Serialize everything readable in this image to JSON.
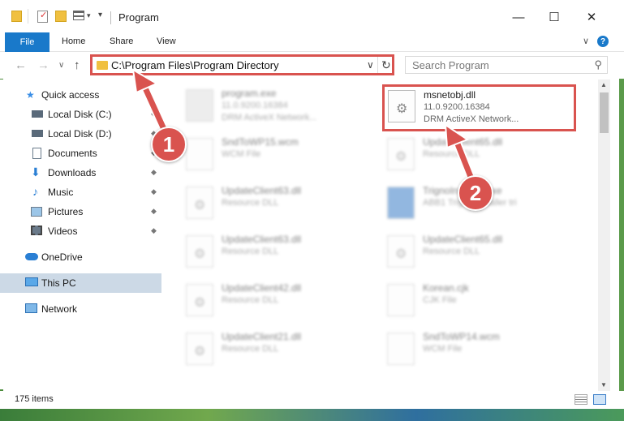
{
  "window": {
    "title": "Program",
    "minimize_glyph": "—",
    "maximize_glyph": "☐",
    "close_glyph": "✕"
  },
  "ribbon": {
    "tabs": [
      "File",
      "Home",
      "Share",
      "View"
    ],
    "help_glyph": "?",
    "collapse_glyph": "∨"
  },
  "nav": {
    "back_glyph": "←",
    "forward_glyph": "→",
    "recent_glyph": "∨",
    "up_glyph": "↑",
    "address_path": "C:\\Program Files\\Program Directory",
    "address_dropdown_glyph": "∨",
    "refresh_glyph": "↻",
    "search_placeholder": "Search Program",
    "search_icon_glyph": "⚲"
  },
  "sidebar": {
    "items": [
      {
        "label": "Quick access",
        "icon": "star-icon",
        "pinned": false
      },
      {
        "label": "Local Disk (C:)",
        "icon": "drive-icon",
        "pinned": true
      },
      {
        "label": "Local Disk (D:)",
        "icon": "drive-icon",
        "pinned": true
      },
      {
        "label": "Documents",
        "icon": "documents-icon",
        "pinned": true
      },
      {
        "label": "Downloads",
        "icon": "download-icon",
        "pinned": true
      },
      {
        "label": "Music",
        "icon": "music-icon",
        "pinned": true
      },
      {
        "label": "Pictures",
        "icon": "pictures-icon",
        "pinned": true
      },
      {
        "label": "Videos",
        "icon": "videos-icon",
        "pinned": true
      },
      {
        "label": "OneDrive",
        "icon": "cloud-icon",
        "pinned": false
      },
      {
        "label": "This PC",
        "icon": "computer-icon",
        "pinned": false,
        "selected": true
      },
      {
        "label": "Network",
        "icon": "network-icon",
        "pinned": false
      }
    ],
    "pin_glyph": "📌"
  },
  "files": [
    {
      "name": "program.exe",
      "line1": "11.0.9200.16384",
      "line2": "DRM ActiveX Network..."
    },
    {
      "name": "msnetobj.dll",
      "line1": "11.0.9200.16384",
      "line2": "DRM ActiveX Network..."
    },
    {
      "name": "SndToWP15.wcm",
      "line1": "WCM File",
      "line2": ""
    },
    {
      "name": "UpdateClient65.dll",
      "line1": "Resource DLL",
      "line2": ""
    },
    {
      "name": "UpdateClient63.dll",
      "line1": "Resource DLL",
      "line2": ""
    },
    {
      "name": "TrignoInstaller.exe",
      "line1": "ABB1 Trigno Installer tri",
      "line2": ""
    },
    {
      "name": "UpdateClient63.dll",
      "line1": "Resource DLL",
      "line2": ""
    },
    {
      "name": "UpdateClient65.dll",
      "line1": "Resource DLL",
      "line2": ""
    },
    {
      "name": "UpdateClient42.dll",
      "line1": "Resource DLL",
      "line2": ""
    },
    {
      "name": "Korean.cjk",
      "line1": "CJK File",
      "line2": ""
    },
    {
      "name": "UpdateClient21.dll",
      "line1": "Resource DLL",
      "line2": ""
    },
    {
      "name": "SndToWP14.wcm",
      "line1": "WCM File",
      "line2": ""
    }
  ],
  "status": {
    "item_count": "175 items"
  },
  "callouts": [
    "1",
    "2"
  ],
  "colors": {
    "accent": "#1979ca",
    "highlight_border": "#d9534f",
    "selected_bg": "#ccd9e6"
  }
}
